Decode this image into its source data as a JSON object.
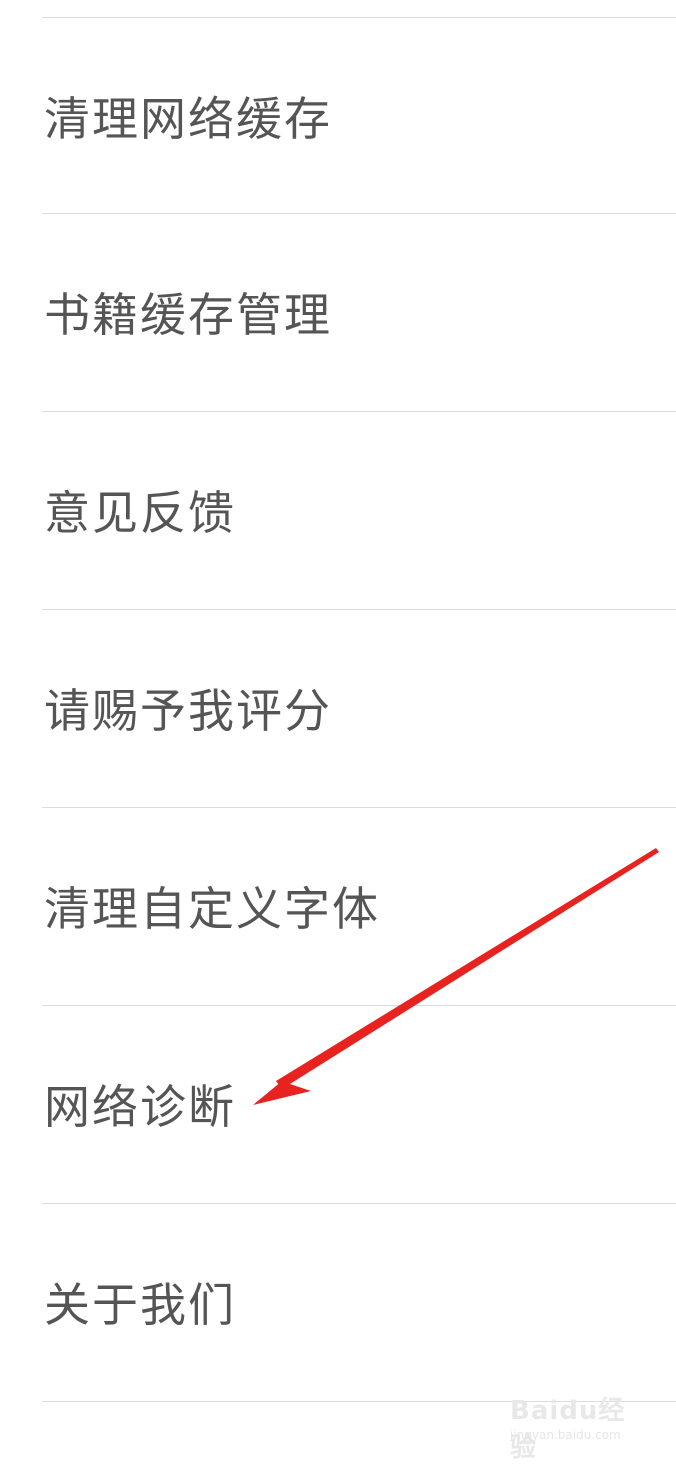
{
  "settings": {
    "items": [
      {
        "label": "清理网络缓存"
      },
      {
        "label": "书籍缓存管理"
      },
      {
        "label": "意见反馈"
      },
      {
        "label": "请赐予我评分"
      },
      {
        "label": "清理自定义字体"
      },
      {
        "label": "网络诊断"
      },
      {
        "label": "关于我们"
      }
    ]
  },
  "annotation": {
    "arrow_color": "#e8221e",
    "target": "网络诊断"
  },
  "watermark": {
    "logo": "Baidu经验",
    "url": "jingyan.baidu.com",
    "color": "#e8e8e8"
  }
}
